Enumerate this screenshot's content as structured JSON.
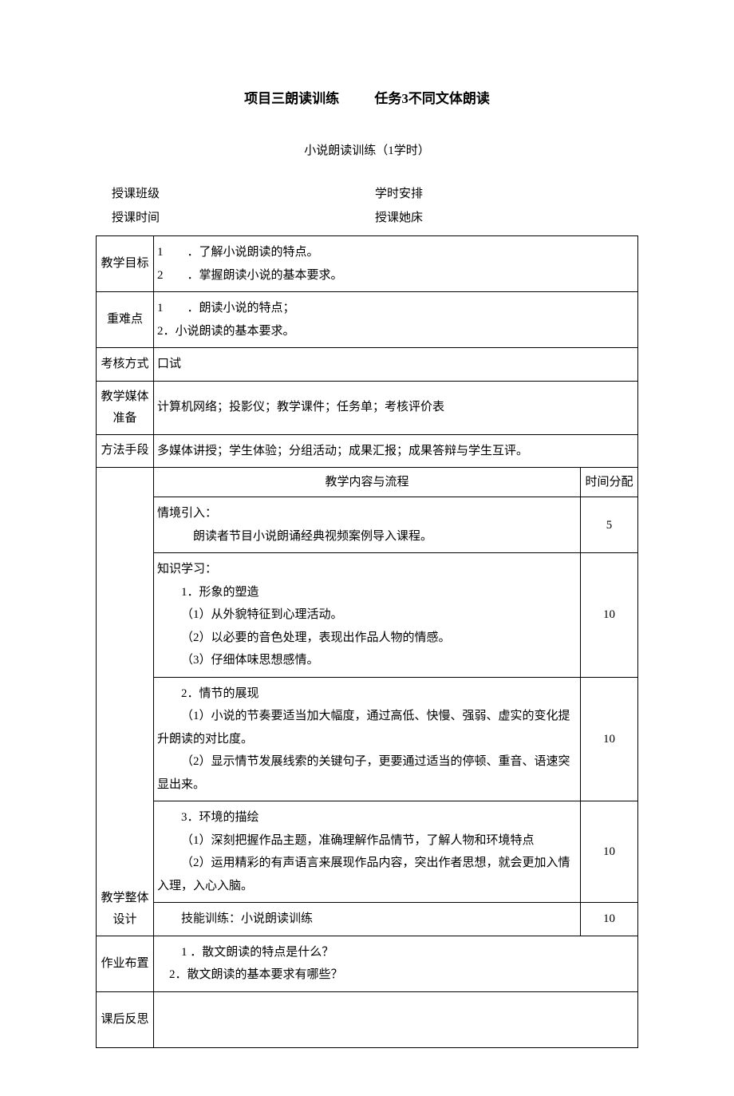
{
  "title": {
    "part1": "项目三朗读训练",
    "part2": "任务3不同文体朗读"
  },
  "subtitle": "小说朗读训练（1学时）",
  "meta": {
    "class_label": "授课班级",
    "class_value": "",
    "hours_label": "学时安排",
    "hours_value": "",
    "time_label": "授课时间",
    "time_value": "",
    "bed_label": "授课她床",
    "bed_value": ""
  },
  "rows": {
    "goal": {
      "label": "教学目标",
      "line1_num": "1",
      "line1_text": "．了解小说朗读的特点。",
      "line2_num": "2",
      "line2_text": "．掌握朗读小说的基本要求。"
    },
    "keypoints": {
      "label": "重难点",
      "line1_num": "1",
      "line1_text": "．朗读小说的特点；",
      "line2": "2．小说朗读的基本要求。"
    },
    "assess": {
      "label": "考核方式",
      "value": "口试"
    },
    "media": {
      "label": "教学媒体准备",
      "value": "计算机网络；投影仪；教学课件；任务单；考核评价表"
    },
    "method": {
      "label": "方法手段",
      "value": "多媒体讲授；学生体验；分组活动；成果汇报；成果答辩与学生互评。"
    },
    "design": {
      "label": "教学整体设计",
      "header_content": "教学内容与流程",
      "header_time": "时间分配",
      "sec1": {
        "l1": "情境引入：",
        "l2": "朗读者节目小说朗诵经典视频案例导入课程。",
        "time": "5"
      },
      "sec2": {
        "l1": "知识学习：",
        "l2": "1．形象的塑造",
        "l3": "（1）从外貌特征到心理活动。",
        "l4": "（2）以必要的音色处理，表现出作品人物的情感。",
        "l5": "（3）仔细体味思想感情。",
        "time": "10"
      },
      "sec3": {
        "l1": "2．情节的展现",
        "l2": "（1）小说的节奏要适当加大幅度，通过高低、快慢、强弱、虚实的变化提升朗读的对比度。",
        "l3": "（2）显示情节发展线索的关键句子，更要通过适当的停顿、重音、语速突显出来。",
        "time": "10"
      },
      "sec4": {
        "l1": "3．环境的描绘",
        "l2": "（1）深刻把握作品主题，准确理解作品情节，了解人物和环境特点",
        "l3": "（2）运用精彩的有声语言来展现作品内容，突出作者思想，就会更加入情入理，入心入脑。",
        "time": "10"
      },
      "sec5": {
        "l1": "技能训练：小说朗读训练",
        "time": "10"
      }
    },
    "homework": {
      "label": "作业布置",
      "l1_num": "1",
      "l1_text": "．散文朗读的特点是什么？",
      "l2": "2．散文朗读的基本要求有哪些？"
    },
    "reflect": {
      "label": "课后反思",
      "value": ""
    }
  }
}
